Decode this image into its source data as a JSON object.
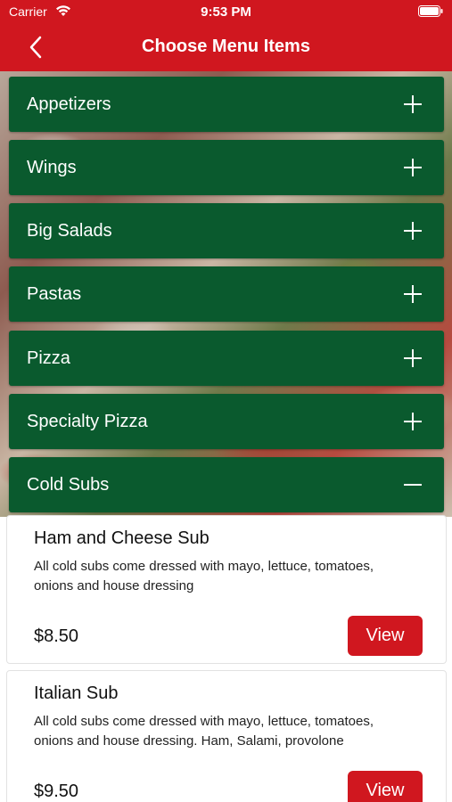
{
  "status_bar": {
    "carrier": "Carrier",
    "time": "9:53 PM"
  },
  "header": {
    "title": "Choose Menu Items"
  },
  "colors": {
    "brand_red": "#d0171f",
    "category_green": "#0a5a2e"
  },
  "categories": [
    {
      "label": "Appetizers",
      "expanded": false
    },
    {
      "label": "Wings",
      "expanded": false
    },
    {
      "label": "Big Salads",
      "expanded": false
    },
    {
      "label": "Pastas",
      "expanded": false
    },
    {
      "label": "Pizza",
      "expanded": false
    },
    {
      "label": "Specialty Pizza",
      "expanded": false
    },
    {
      "label": "Cold Subs",
      "expanded": true
    }
  ],
  "items": [
    {
      "name": "Ham and Cheese Sub",
      "description": "All cold subs come dressed with mayo, lettuce, tomatoes, onions and house dressing",
      "price": "$8.50",
      "button": "View"
    },
    {
      "name": "Italian Sub",
      "description": "All cold subs come dressed with mayo, lettuce, tomatoes, onions and house dressing. Ham, Salami, provolone",
      "price": "$9.50",
      "button": "View"
    }
  ]
}
